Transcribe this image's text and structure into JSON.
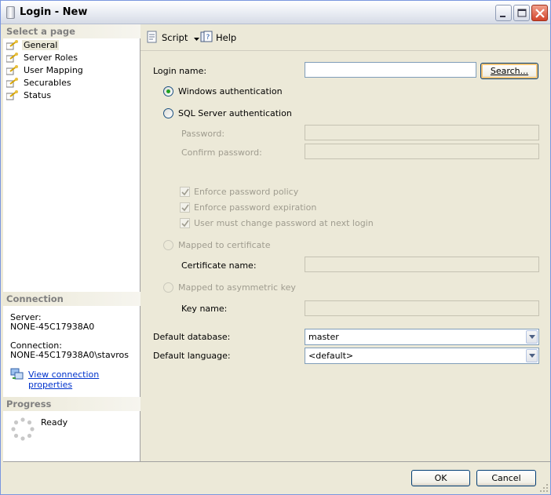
{
  "window": {
    "title": "Login - New",
    "title_icon": "document-icon",
    "controls": [
      "minimize",
      "maximize",
      "close"
    ]
  },
  "sidebar": {
    "select_page_header": "Select a page",
    "pages": [
      {
        "label": "General",
        "icon": "page-icon",
        "selected": true
      },
      {
        "label": "Server Roles",
        "icon": "page-icon"
      },
      {
        "label": "User Mapping",
        "icon": "page-icon"
      },
      {
        "label": "Securables",
        "icon": "page-icon"
      },
      {
        "label": "Status",
        "icon": "page-icon"
      }
    ],
    "connection_header": "Connection",
    "server_label": "Server:",
    "server_value": "NONE-45C17938A0",
    "connection_label": "Connection:",
    "connection_value": "NONE-45C17938A0\\stavros",
    "view_connection_link": "View connection properties",
    "progress_header": "Progress",
    "progress_status": "Ready"
  },
  "toolbar": {
    "script_label": "Script",
    "help_label": "Help"
  },
  "form": {
    "login_name_label": "Login name:",
    "login_name_value": "",
    "search_button": "Search...",
    "windows_auth_label": "Windows authentication",
    "windows_auth_selected": true,
    "sql_auth_label": "SQL Server authentication",
    "password_label": "Password:",
    "confirm_password_label": "Confirm password:",
    "enforce_policy_label": "Enforce password policy",
    "enforce_expiration_label": "Enforce password expiration",
    "must_change_label": "User must change password at next login",
    "mapped_cert_label": "Mapped to certificate",
    "certificate_name_label": "Certificate name:",
    "mapped_key_label": "Mapped to asymmetric key",
    "key_name_label": "Key name:",
    "default_database_label": "Default database:",
    "default_database_value": "master",
    "default_language_label": "Default language:",
    "default_language_value": "<default>"
  },
  "footer": {
    "ok_button": "OK",
    "cancel_button": "Cancel"
  },
  "colors": {
    "dialog_bg": "#ece9d8",
    "link": "#0033cc",
    "radio_selected": "#21a121"
  }
}
